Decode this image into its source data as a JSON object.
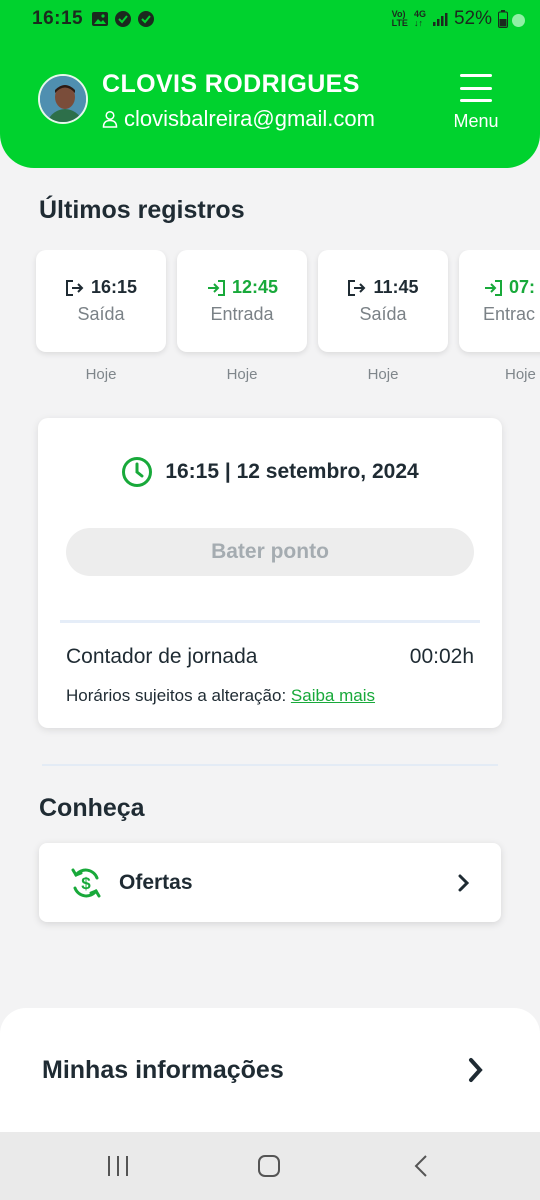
{
  "status_bar": {
    "time": "16:15",
    "net_top": "Vo)",
    "net_bottom": "LTE",
    "net2_top": "4G",
    "net2_bottom": "↓↑",
    "battery": "52%"
  },
  "header": {
    "user_name": "CLOVIS RODRIGUES",
    "user_email": "clovisbalreira@gmail.com",
    "menu_label": "Menu"
  },
  "records_section": {
    "title": "Últimos registros",
    "items": [
      {
        "time": "16:15",
        "type": "Saída",
        "day": "Hoje",
        "kind": "exit"
      },
      {
        "time": "12:45",
        "type": "Entrada",
        "day": "Hoje",
        "kind": "entry"
      },
      {
        "time": "11:45",
        "type": "Saída",
        "day": "Hoje",
        "kind": "exit"
      },
      {
        "time": "07:",
        "type": "Entrac",
        "day": "Hoje",
        "kind": "entry"
      }
    ]
  },
  "clock_card": {
    "datetime": "16:15 | 12 setembro, 2024",
    "punch_button": "Bater ponto",
    "counter_label": "Contador de jornada",
    "counter_value": "00:02h",
    "note_text": "Horários sujeitos a alteração:",
    "note_link": "Saiba mais"
  },
  "discover": {
    "title": "Conheça",
    "offer_label": "Ofertas"
  },
  "info": {
    "label": "Minhas informações"
  },
  "colors": {
    "brand_green": "#00d22e",
    "accent_green": "#18a93a",
    "text_dark": "#1f2b33"
  }
}
